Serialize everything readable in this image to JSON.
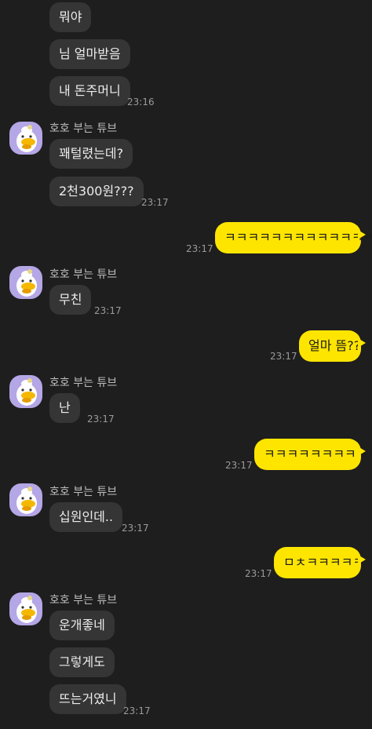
{
  "sender_name": "호호 부는 튜브",
  "colors": {
    "background": "#1e1e1e",
    "incoming": "#353535",
    "outgoing": "#fee500",
    "avatar_bg": "#b5a6e6"
  },
  "icons": {
    "avatar": "tube-duck-avatar-icon"
  },
  "messages": [
    {
      "from": "them",
      "text": "뭐야"
    },
    {
      "from": "them",
      "text": "님 얼마받음"
    },
    {
      "from": "them",
      "text": "내 돈주머니",
      "time": "23:16"
    },
    {
      "from": "them",
      "sender": "호호 부는 튜브",
      "text": "꽤털렸는데?"
    },
    {
      "from": "them",
      "text": "2천300원???",
      "time": "23:17"
    },
    {
      "from": "me",
      "text": "ㅋㅋㅋㅋㅋㅋㅋㅋㅋㅋㅋㅋㅋ",
      "time": "23:17"
    },
    {
      "from": "them",
      "sender": "호호 부는 튜브",
      "text": "무친",
      "time": "23:17"
    },
    {
      "from": "me",
      "text": "얼마 뜸??",
      "time": "23:17"
    },
    {
      "from": "them",
      "sender": "호호 부는 튜브",
      "text": "난",
      "time": "23:17"
    },
    {
      "from": "me",
      "text": "ㅋㅋㅋㅋㅋㅋㅋㅋㅋㅋ",
      "time": "23:17"
    },
    {
      "from": "them",
      "sender": "호호 부는 튜브",
      "text": "십원인데..",
      "time": "23:17"
    },
    {
      "from": "me",
      "text": "ㅁㅊㅋㅋㅋㅋㅋ",
      "time": "23:17"
    },
    {
      "from": "them",
      "sender": "호호 부는 튜브",
      "text": "운개좋네"
    },
    {
      "from": "them",
      "text": "그렇게도"
    },
    {
      "from": "them",
      "text": "뜨는거였니",
      "time": "23:17"
    }
  ]
}
